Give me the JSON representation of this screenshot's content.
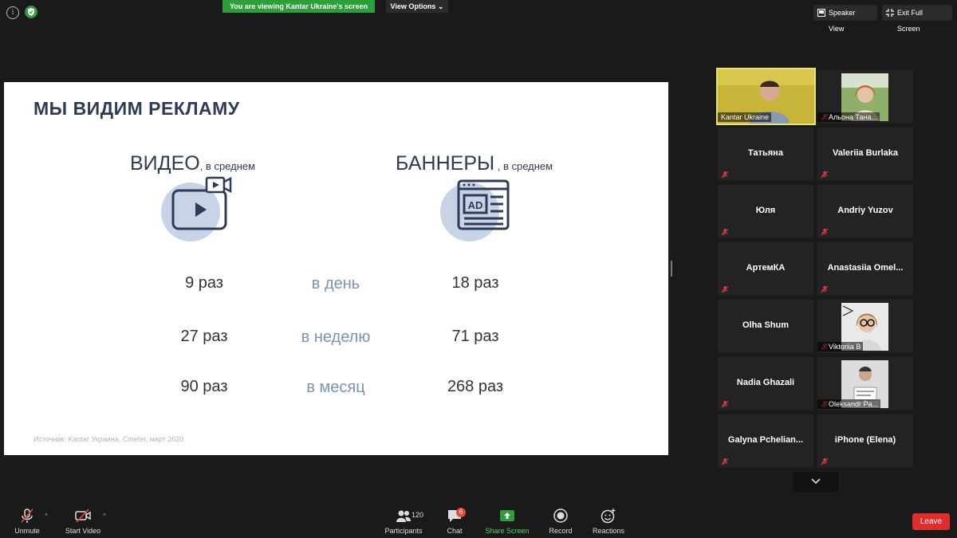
{
  "topbar": {
    "banner_text": "You are viewing Kantar Ukraine's screen",
    "view_options_label": "View Options ⌄",
    "speaker_view_label": "Speaker View",
    "exit_fullscreen_label": "Exit Full Screen",
    "info_glyph": "i"
  },
  "slide": {
    "title": "МЫ ВИДИМ РЕКЛАМУ",
    "video_heading": "ВИДЕО",
    "video_sub": ", в среднем",
    "banner_heading": "БАННЕРЫ",
    "banner_sub": " , в среднем",
    "ad_icon_text": "AD",
    "rows": [
      {
        "video": "9 раз",
        "period": "в день",
        "banner": "18 раз"
      },
      {
        "video": "27 раз",
        "period": "в неделю",
        "banner": "71 раз"
      },
      {
        "video": "90 раз",
        "period": "в месяц",
        "banner": "268 раз"
      }
    ],
    "source": "Источник: Kantar Украина, Cmeter, март 2020"
  },
  "participants": [
    {
      "name": "Kantar Ukraine",
      "speaking": true,
      "photo": true,
      "muted": false
    },
    {
      "name": "Альона Тана...",
      "speaking": false,
      "photo": true,
      "muted": true
    },
    {
      "name": "Татьяна",
      "muted": true
    },
    {
      "name": "Valeriia Burlaka",
      "muted": true
    },
    {
      "name": "Юля",
      "muted": true
    },
    {
      "name": "Andriy Yuzov",
      "muted": true
    },
    {
      "name": "АртемКА",
      "muted": true
    },
    {
      "name": "Anastasiia  Omel...",
      "muted": true
    },
    {
      "name": "Olha Shum",
      "muted": true
    },
    {
      "name": "Viktoriia B",
      "photo": true,
      "muted": true
    },
    {
      "name": "Nadia Ghazali",
      "muted": true
    },
    {
      "name": "Oleksandr Pa...",
      "photo": true,
      "muted": true
    },
    {
      "name": "Galyna  Pchelian...",
      "muted": true
    },
    {
      "name": "iPhone (Elena)",
      "muted": true
    }
  ],
  "toolbar": {
    "unmute_label": "Unmute",
    "start_video_label": "Start Video",
    "participants_label": "Participants",
    "participants_count": "120",
    "chat_label": "Chat",
    "chat_badge": "6",
    "share_label": "Share Screen",
    "record_label": "Record",
    "reactions_label": "Reactions",
    "leave_label": "Leave",
    "caret_glyph": "^"
  },
  "colors": {
    "banner_green": "#2d9f3a",
    "share_green": "#4cd964",
    "leave_red": "#e02c2c",
    "speaker_border": "#e9e36a",
    "slide_navy": "#2f3b56",
    "slide_period_blue": "#7b93b6"
  }
}
